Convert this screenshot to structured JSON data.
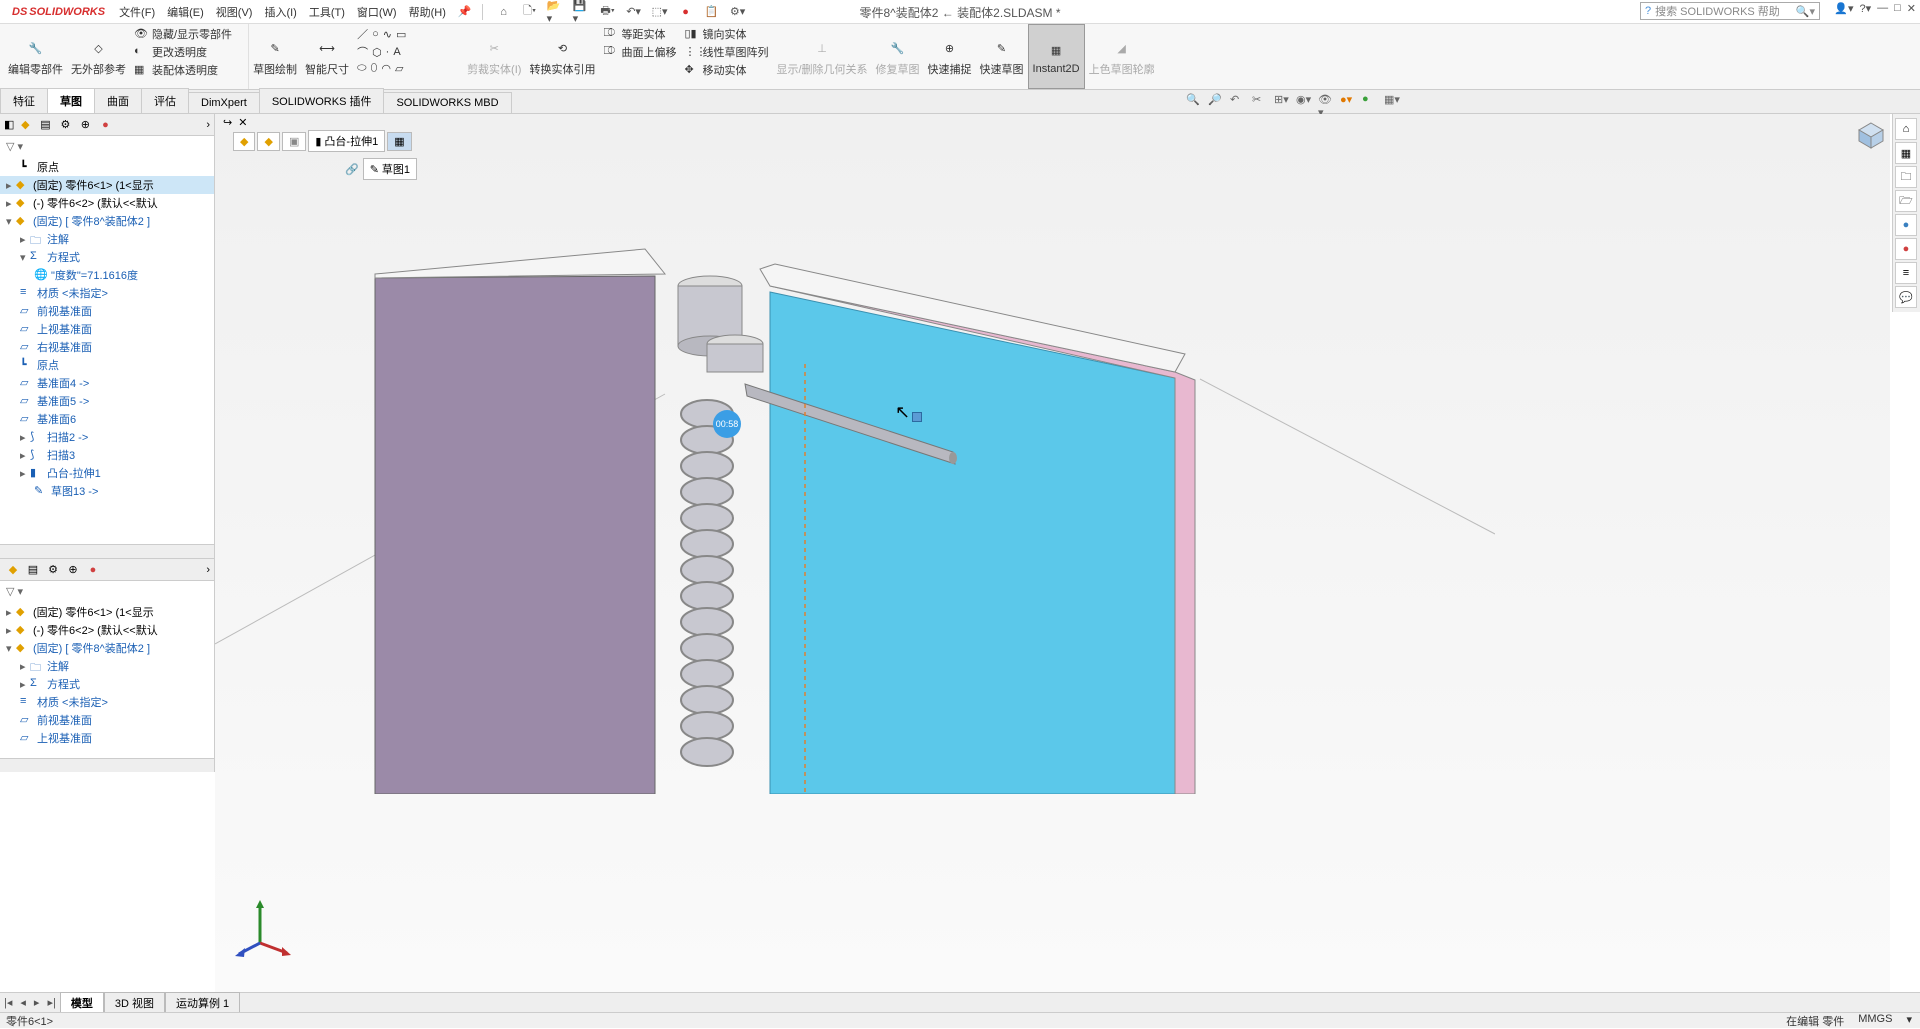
{
  "app": {
    "logo_text": "SOLIDWORKS",
    "doc_title": "零件8^装配体2 ← 装配体2.SLDASM *",
    "search_placeholder": "搜索 SOLIDWORKS 帮助"
  },
  "menu": {
    "file": "文件(F)",
    "edit": "编辑(E)",
    "view": "视图(V)",
    "insert": "插入(I)",
    "tools": "工具(T)",
    "window": "窗口(W)",
    "help": "帮助(H)"
  },
  "ribbon": {
    "edit_component": "编辑零部件",
    "no_external_ref": "无外部参考",
    "hide_show": "隐藏/显示零部件",
    "change_trans": "更改透明度",
    "asm_trans": "装配体透明度",
    "sketch": "草图绘制",
    "smart_dim": "智能尺寸",
    "trim": "剪裁实体(I)",
    "convert": "转换实体引用",
    "equidistant": "等距实体",
    "surface_offset": "曲面上偏移",
    "mirror": "镜向实体",
    "linear_pattern": "线性草图阵列",
    "move": "移动实体",
    "display_rel": "显示/删除几何关系",
    "repair": "修复草图",
    "quick_snap": "快速捕捉",
    "rapid": "快速草图",
    "instant2d": "Instant2D",
    "shaded_outline": "上色草图轮廓"
  },
  "tabs": {
    "feature": "特征",
    "sketch": "草图",
    "surface": "曲面",
    "evaluate": "评估",
    "dimxpert": "DimXpert",
    "addins": "SOLIDWORKS 插件",
    "mbd": "SOLIDWORKS MBD"
  },
  "tree1": {
    "origin": "原点",
    "part6_1": "(固定) 零件6<1> (1<显示",
    "part6_2": "(-) 零件6<2> (默认<<默认",
    "part8": "(固定) [ 零件8^装配体2 ]",
    "annotations": "注解",
    "equations": "方程式",
    "eq_value": "\"度数\"=71.1616度",
    "material": "材质 <未指定>",
    "front": "前视基准面",
    "top": "上视基准面",
    "right": "右视基准面",
    "origin2": "原点",
    "plane4": "基准面4 ->",
    "plane5": "基准面5 ->",
    "plane6": "基准面6",
    "sweep2": "扫描2 ->",
    "sweep3": "扫描3",
    "boss_extrude1": "凸台-拉伸1",
    "sketch13": "草图13 ->"
  },
  "breadcrumb": {
    "feature": "凸台-拉伸1",
    "sketch": "草图1"
  },
  "bottom": {
    "model": "模型",
    "view3d": "3D 视图",
    "motion": "运动算例 1"
  },
  "status": {
    "left": "零件6<1>",
    "editing": "在编辑 零件",
    "units": "MMGS"
  },
  "timer": "00:58"
}
